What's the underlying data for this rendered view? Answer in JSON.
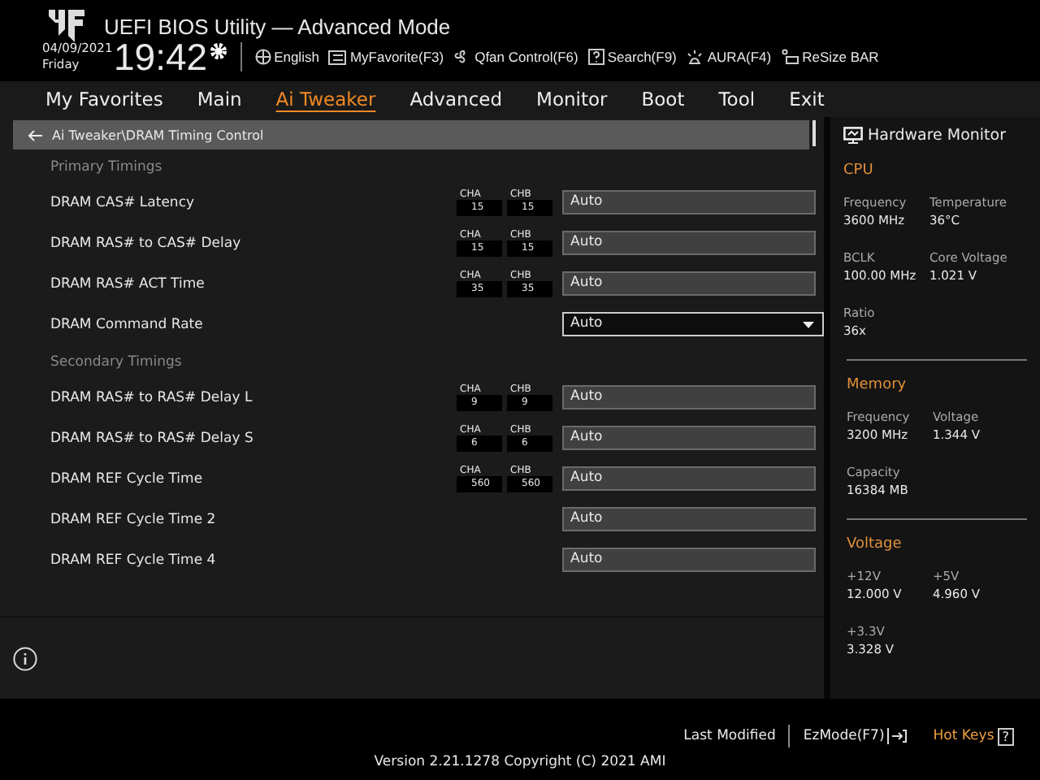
{
  "header": {
    "title": "UEFI BIOS Utility — Advanced Mode",
    "date": "04/09/2021",
    "day": "Friday",
    "time": "19:42",
    "tools": [
      {
        "kind": "globe",
        "label": "English"
      },
      {
        "kind": "list",
        "label": "MyFavorite(F3)"
      },
      {
        "kind": "fan",
        "label": "Qfan Control(F6)"
      },
      {
        "kind": "help",
        "label": "Search(F9)"
      },
      {
        "kind": "light",
        "label": "AURA(F4)"
      },
      {
        "kind": "card",
        "label": "ReSize BAR"
      }
    ]
  },
  "tabs": [
    {
      "label": "My Favorites",
      "selected": false
    },
    {
      "label": "Main",
      "selected": false
    },
    {
      "label": "Ai Tweaker",
      "selected": true
    },
    {
      "label": "Advanced",
      "selected": false
    },
    {
      "label": "Monitor",
      "selected": false
    },
    {
      "label": "Boot",
      "selected": false
    },
    {
      "label": "Tool",
      "selected": false
    },
    {
      "label": "Exit",
      "selected": false
    }
  ],
  "breadcrumb": "Ai Tweaker\\DRAM Timing Control",
  "rows": [
    {
      "kind": "heading",
      "label": "Primary Timings"
    },
    {
      "kind": "timing",
      "label": "DRAM CAS# Latency",
      "cha_label": "CHA",
      "cha": "15",
      "chb_label": "CHB",
      "chb": "15",
      "value": "Auto"
    },
    {
      "kind": "timing",
      "label": "DRAM RAS# to CAS# Delay",
      "cha_label": "CHA",
      "cha": "15",
      "chb_label": "CHB",
      "chb": "15",
      "value": "Auto"
    },
    {
      "kind": "timing",
      "label": "DRAM RAS# ACT Time",
      "cha_label": "CHA",
      "cha": "35",
      "chb_label": "CHB",
      "chb": "35",
      "value": "Auto"
    },
    {
      "kind": "dropdown",
      "label": "DRAM Command Rate",
      "value": "Auto"
    },
    {
      "kind": "heading",
      "label": "Secondary Timings"
    },
    {
      "kind": "timing",
      "label": "DRAM RAS# to RAS# Delay L",
      "cha_label": "CHA",
      "cha": "9",
      "chb_label": "CHB",
      "chb": "9",
      "value": "Auto"
    },
    {
      "kind": "timing",
      "label": "DRAM RAS# to RAS# Delay S",
      "cha_label": "CHA",
      "cha": "6",
      "chb_label": "CHB",
      "chb": "6",
      "value": "Auto"
    },
    {
      "kind": "timing",
      "label": "DRAM REF Cycle Time",
      "cha_label": "CHA",
      "cha": "560",
      "chb_label": "CHB",
      "chb": "560",
      "value": "Auto"
    },
    {
      "kind": "field",
      "label": "DRAM REF Cycle Time 2",
      "value": "Auto"
    },
    {
      "kind": "field",
      "label": "DRAM REF Cycle Time 4",
      "value": "Auto"
    }
  ],
  "monitor": {
    "title": "Hardware Monitor",
    "sections": [
      {
        "title": "CPU",
        "items": [
          {
            "label": "Frequency",
            "value": "3600 MHz"
          },
          {
            "label": "Temperature",
            "value": "36°C"
          },
          {
            "label": "BCLK",
            "value": "100.00 MHz"
          },
          {
            "label": "Core Voltage",
            "value": "1.021 V"
          },
          {
            "label": "Ratio",
            "value": "36x"
          }
        ]
      },
      {
        "title": "Memory",
        "items": [
          {
            "label": "Frequency",
            "value": "3200 MHz"
          },
          {
            "label": "Voltage",
            "value": "1.344 V"
          },
          {
            "label": "Capacity",
            "value": "16384 MB"
          }
        ]
      },
      {
        "title": "Voltage",
        "items": [
          {
            "label": "+12V",
            "value": "12.000 V"
          },
          {
            "label": "+5V",
            "value": "4.960 V"
          },
          {
            "label": "+3.3V",
            "value": "3.328 V"
          }
        ]
      }
    ]
  },
  "footer": {
    "last_modified": "Last Modified",
    "ezmode": "EzMode(F7)",
    "hotkeys": "Hot Keys",
    "hotkeys_key": "?",
    "version": "Version 2.21.1278 Copyright (C) 2021 AMI"
  }
}
